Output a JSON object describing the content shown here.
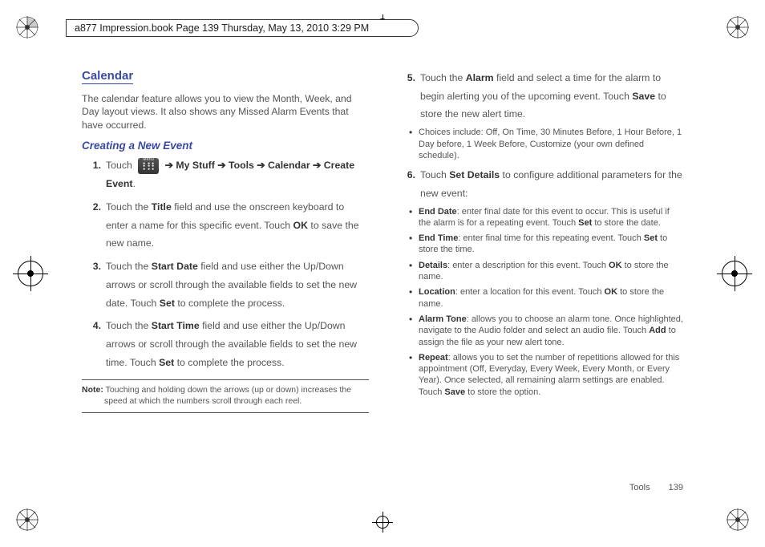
{
  "header": {
    "stamp": "a877 Impression.book  Page 139  Thursday, May 13, 2010  3:29 PM"
  },
  "section": {
    "title": "Calendar",
    "intro": "The calendar feature allows you to view the Month, Week, and Day layout views. It also shows any Missed Alarm Events that have occurred.",
    "subhead": "Creating a New Event"
  },
  "steps_left": [
    {
      "n": "1.",
      "pre": "Touch ",
      "chip_label": "Menu",
      "path": " ➔ My Stuff ➔ Tools ➔ Calendar ➔ Create Event",
      "post": "."
    },
    {
      "n": "2.",
      "text": "Touch the Title field and use the onscreen keyboard to enter a name for this specific event. Touch OK to save the new name.",
      "bolds": [
        "Title",
        "OK"
      ]
    },
    {
      "n": "3.",
      "text": "Touch the Start Date field and use either the Up/Down arrows or scroll through the available fields to set the new date. Touch Set to complete the process.",
      "bolds": [
        "Start Date",
        "Set"
      ]
    },
    {
      "n": "4.",
      "text": "Touch the Start Time field and use either the Up/Down arrows or scroll through the available fields to set the new time. Touch Set to complete the process.",
      "bolds": [
        "Start Time",
        "Set"
      ]
    }
  ],
  "note": {
    "lead": "Note:",
    "text": "Touching and holding down the arrows (up or down) increases the speed at which the numbers scroll through each reel."
  },
  "steps_right": [
    {
      "n": "5.",
      "text": "Touch the Alarm field and select a time for the alarm to begin alerting you of the upcoming event. Touch Save to store the new alert time.",
      "bolds": [
        "Alarm",
        "Save"
      ],
      "sub": [
        "Choices include: Off, On Time, 30 Minutes Before, 1 Hour Before, 1 Day before, 1 Week Before, Customize (your own defined schedule)."
      ]
    },
    {
      "n": "6.",
      "text": "Touch Set Details to configure additional parameters for the new event:",
      "bolds": [
        "Set Details"
      ],
      "sub2": [
        {
          "b": "End Date",
          "t": ": enter final date for this event to occur. This is useful if the alarm is for a repeating event. Touch ",
          "b2": "Set",
          "t2": " to store the date."
        },
        {
          "b": "End Time",
          "t": ": enter final time for this repeating event. Touch ",
          "b2": "Set",
          "t2": " to store the time."
        },
        {
          "b": "Details",
          "t": ": enter a description for this event. Touch ",
          "b2": "OK",
          "t2": " to store the name."
        },
        {
          "b": "Location",
          "t": ": enter a location for this event. Touch ",
          "b2": "OK",
          "t2": " to store the name."
        },
        {
          "b": "Alarm Tone",
          "t": ": allows you to choose an alarm tone. Once highlighted, navigate to the Audio folder and select an audio file. Touch ",
          "b2": "Add",
          "t2": " to assign the file as your new alert tone."
        },
        {
          "b": "Repeat",
          "t": ": allows you to set the number of repetitions allowed for this appointment (Off, Everyday, Every Week, Every Month, or Every Year). Once selected, all remaining alarm settings are enabled. Touch ",
          "b2": "Save",
          "t2": " to store the option."
        }
      ]
    }
  ],
  "footer": {
    "section_name": "Tools",
    "page_number": "139"
  }
}
